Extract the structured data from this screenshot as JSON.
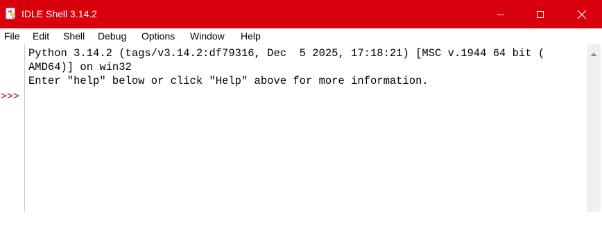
{
  "window": {
    "title": "IDLE Shell 3.14.2",
    "title_bar_color": "#d7000c",
    "app_icon": "python-idle-icon",
    "controls": {
      "minimize_icon": "minimize-icon",
      "maximize_icon": "maximize-icon",
      "close_icon": "close-icon"
    }
  },
  "menu": {
    "items": [
      "File",
      "Edit",
      "Shell",
      "Debug",
      "Options",
      "Window",
      "Help"
    ]
  },
  "shell": {
    "lines": [
      "Python 3.14.2 (tags/v3.14.2:df79316, Dec  5 2025, 17:18:21) [MSC v.1944 64 bit (",
      "AMD64)] on win32",
      "Enter \"help\" below or click \"Help\" above for more information."
    ],
    "prompt": ">>>",
    "prompt_color": "#9b2a2a",
    "input_value": ""
  },
  "scrollbar": {
    "up_arrow_icon": "scroll-up-arrow-icon"
  }
}
